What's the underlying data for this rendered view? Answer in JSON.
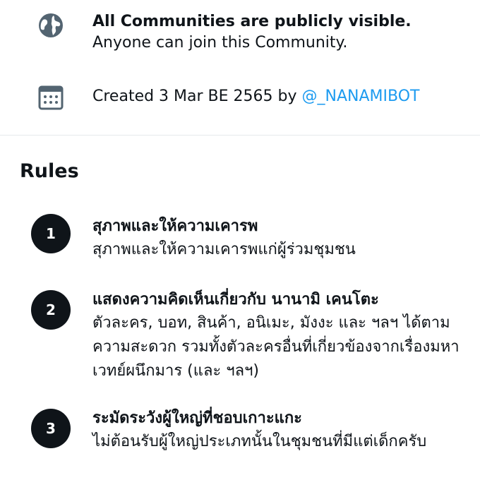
{
  "visibility": {
    "icon": "globe-icon",
    "title": "All Communities are publicly visible.",
    "subtitle": "Anyone can join this Community."
  },
  "created": {
    "icon": "calendar-icon",
    "text": "Created 3 Mar BE 2565 by ",
    "author": "@_NANAMIBOT"
  },
  "rules": {
    "heading": "Rules",
    "items": [
      {
        "number": "1",
        "title": "สุภาพและให้ความเคารพ",
        "description": "สุภาพและให้ความเคารพแก่ผู้ร่วมชุมชน"
      },
      {
        "number": "2",
        "title": "แสดงความคิดเห็นเกี่ยวกับ นานามิ เคนโตะ",
        "description": "ตัวละคร, บอท, สินค้า, อนิเมะ, มังงะ และ ฯลฯ ได้ตามความสะดวก รวมทั้งตัวละครอื่นที่เกี่ยวข้องจากเรื่องมหาเวทย์ผนึกมาร (และ ฯลฯ)"
      },
      {
        "number": "3",
        "title": "ระมัดระวังผู้ใหญ่ที่ชอบเกาะแกะ",
        "description": "ไม่ต้อนรับผู้ใหญ่ประเภทนั้นในชุมชนที่มีแต่เด็กครับ"
      }
    ]
  },
  "colors": {
    "text": "#0f1419",
    "link": "#1d9bf0",
    "icon": "#536471",
    "badge": "#0f1419"
  }
}
